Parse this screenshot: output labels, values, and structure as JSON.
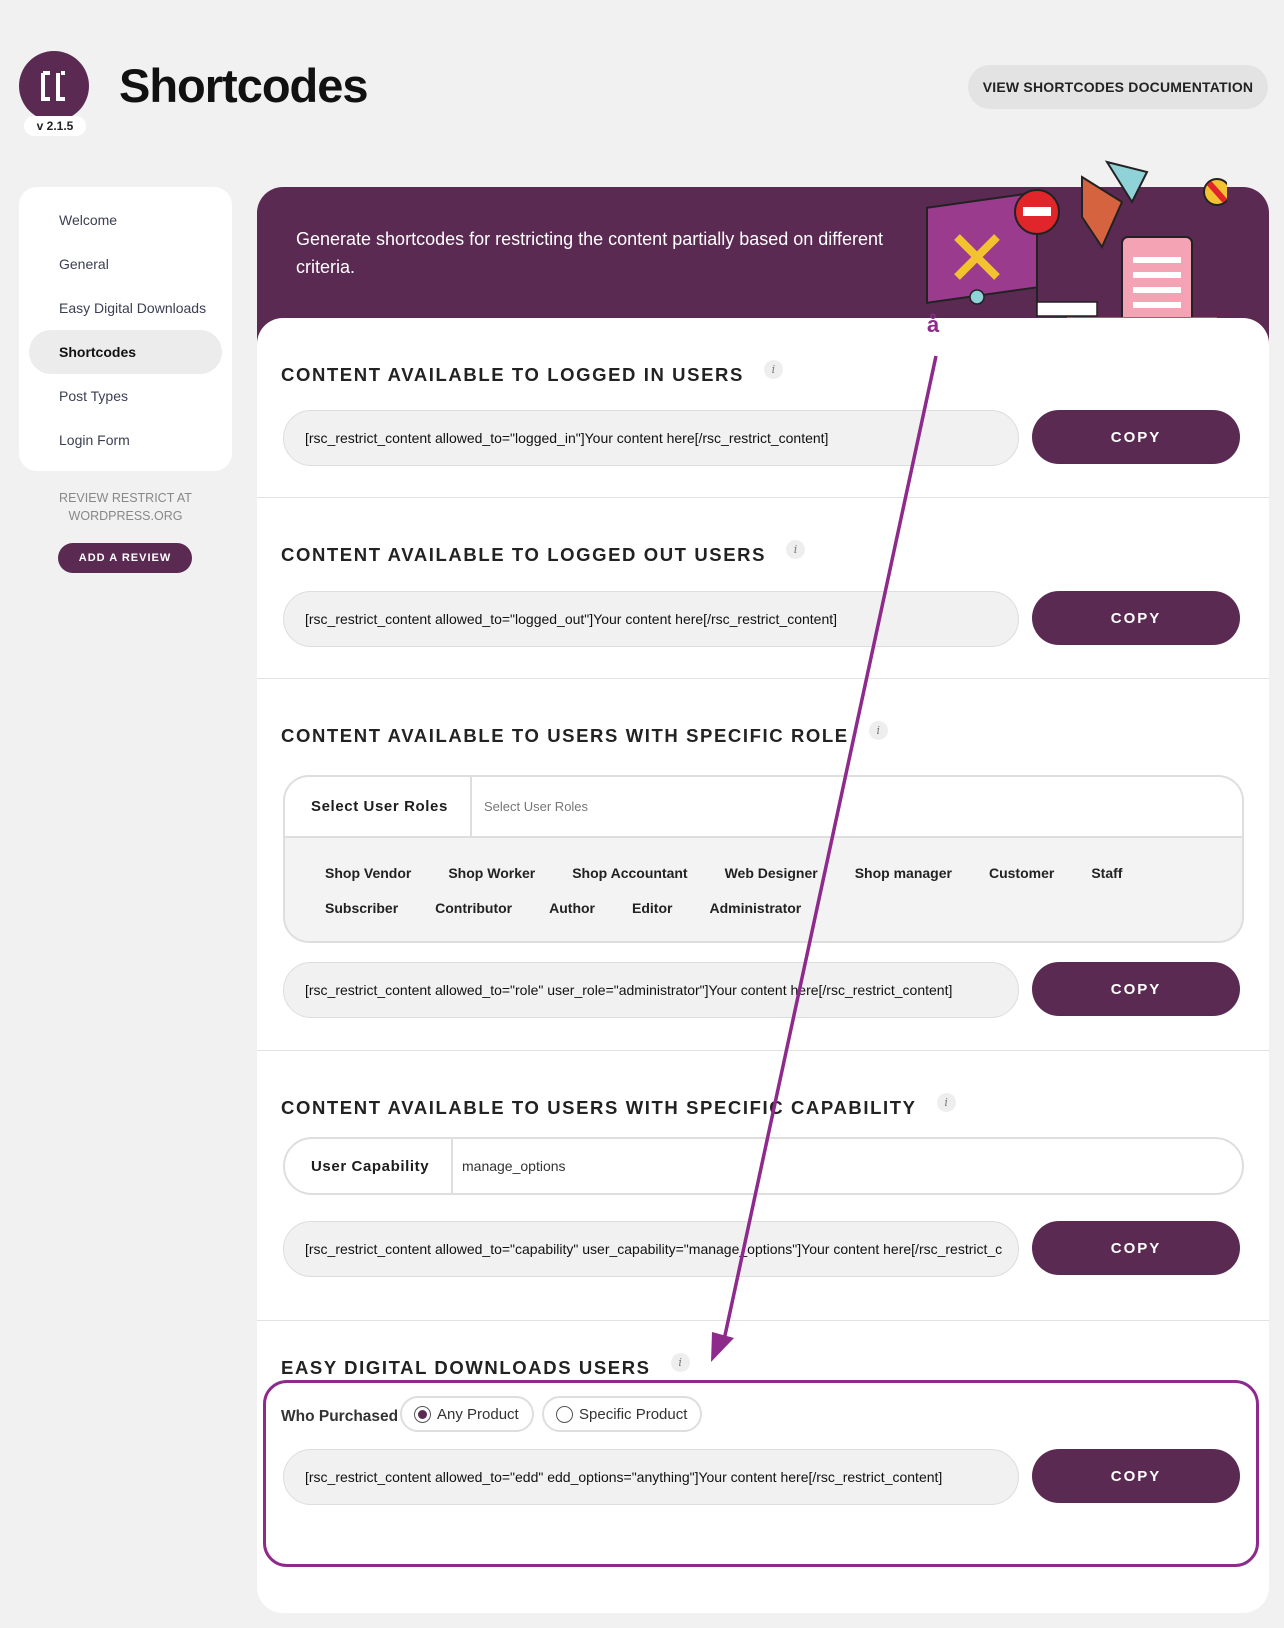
{
  "header": {
    "title": "Shortcodes",
    "version": "v 2.1.5",
    "doc_button": "VIEW SHORTCODES DOCUMENTATION"
  },
  "sidebar": {
    "items": [
      {
        "label": "Welcome"
      },
      {
        "label": "General"
      },
      {
        "label": "Easy Digital Downloads"
      },
      {
        "label": "Shortcodes"
      },
      {
        "label": "Post Types"
      },
      {
        "label": "Login Form"
      }
    ],
    "review_text": "REVIEW RESTRICT AT WORDPRESS.ORG",
    "review_button": "ADD A REVIEW"
  },
  "banner": {
    "text": "Generate shortcodes for restricting the content partially based on different criteria."
  },
  "annotation": {
    "marker": "å"
  },
  "sections": {
    "logged_in": {
      "title": "CONTENT AVAILABLE TO LOGGED IN USERS",
      "code": "[rsc_restrict_content allowed_to=\"logged_in\"]Your content here[/rsc_restrict_content]",
      "copy": "COPY"
    },
    "logged_out": {
      "title": "CONTENT AVAILABLE TO LOGGED OUT USERS",
      "code": "[rsc_restrict_content allowed_to=\"logged_out\"]Your content here[/rsc_restrict_content]",
      "copy": "COPY"
    },
    "role": {
      "title": "CONTENT AVAILABLE TO USERS WITH SPECIFIC ROLE",
      "select_label": "Select User Roles",
      "select_placeholder": "Select User Roles",
      "roles": [
        "Shop Vendor",
        "Shop Worker",
        "Shop Accountant",
        "Web Designer",
        "Shop manager",
        "Customer",
        "Staff",
        "Subscriber",
        "Contributor",
        "Author",
        "Editor",
        "Administrator"
      ],
      "code": "[rsc_restrict_content allowed_to=\"role\" user_role=\"administrator\"]Your content here[/rsc_restrict_content]",
      "copy": "COPY"
    },
    "capability": {
      "title": "CONTENT AVAILABLE TO USERS WITH SPECIFIC CAPABILITY",
      "label": "User Capability",
      "value": "manage_options",
      "code": "[rsc_restrict_content allowed_to=\"capability\" user_capability=\"manage_options\"]Your content here[/rsc_restrict_c",
      "copy": "COPY"
    },
    "edd": {
      "title": "EASY DIGITAL DOWNLOADS USERS",
      "who_label": "Who Purchased",
      "option_any": "Any Product",
      "option_specific": "Specific Product",
      "selected": "Any Product",
      "code": "[rsc_restrict_content allowed_to=\"edd\" edd_options=\"anything\"]Your content here[/rsc_restrict_content]",
      "copy": "COPY"
    }
  },
  "colors": {
    "brand": "#5b2a52",
    "annotation": "#8e2a8b",
    "background": "#f1f1f1"
  }
}
